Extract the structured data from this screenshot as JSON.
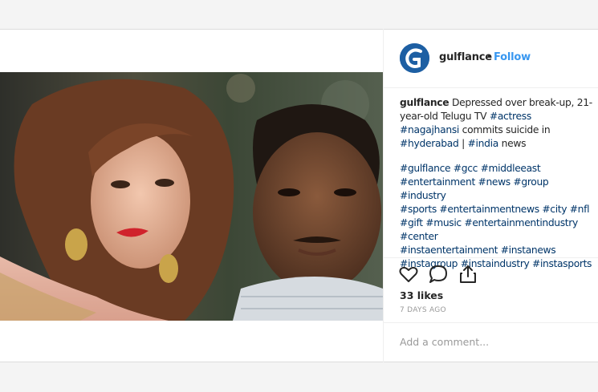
{
  "post": {
    "username": "gulflance",
    "separator": "•",
    "follow_label": "Follow",
    "caption_user": "gulflance",
    "caption_text_1": "Depressed over break-up, 21-year-old Telugu TV",
    "caption_tag_actress": "#actress",
    "caption_tag_nagajhansi": "#nagajhansi",
    "caption_text_2": "commits suicide in",
    "caption_tag_hyderabad": "#hyderabad",
    "caption_text_3": "|",
    "caption_tag_india": "#india",
    "caption_text_4": "news",
    "hashtags_lines": [
      "#gulflance #gcc #middleeast",
      "#entertainment #news #group #industry",
      "#sports #entertainmentnews #city #nfl",
      "#gift #music #entertainmentindustry",
      "#center",
      "#instaentertainment #instanews",
      "#instagroup #instaindustry #instasports"
    ],
    "likes": "33 likes",
    "timestamp": "7 DAYS AGO",
    "comment_placeholder": "Add a comment..."
  },
  "icons": {
    "like": "heart-icon",
    "comment": "comment-bubble-icon",
    "share": "share-icon"
  },
  "colors": {
    "link": "#003569",
    "follow": "#3897f0",
    "avatar": "#1d5fa3"
  }
}
